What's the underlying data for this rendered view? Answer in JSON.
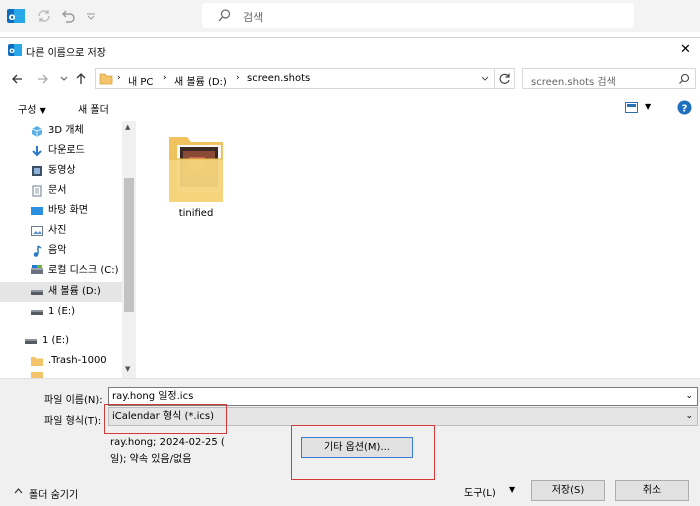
{
  "outlook": {
    "search_placeholder": "검색",
    "icons": [
      "outlook-logo-icon",
      "sync-icon",
      "undo-icon",
      "customize-quick-access-icon",
      "search-icon"
    ]
  },
  "dialog": {
    "title": "다른 이름으로 저장",
    "close_glyph": "✕",
    "breadcrumb": [
      "내 PC",
      "새 볼륨 (D:)",
      "screen.shots"
    ],
    "search_placeholder": "screen.shots 검색",
    "toolbar": {
      "organize": "구성",
      "new_folder": "새 폴더"
    },
    "nav_items": [
      {
        "label": "3D 개체",
        "icon": "3d-objects-icon"
      },
      {
        "label": "다운로드",
        "icon": "download-icon"
      },
      {
        "label": "동영상",
        "icon": "video-icon"
      },
      {
        "label": "문서",
        "icon": "document-icon"
      },
      {
        "label": "바탕 화면",
        "icon": "desktop-icon"
      },
      {
        "label": "사진",
        "icon": "pictures-icon"
      },
      {
        "label": "음악",
        "icon": "music-icon"
      },
      {
        "label": "로컬 디스크 (C:)",
        "icon": "drive-icon"
      },
      {
        "label": "새 볼륨 (D:)",
        "icon": "drive-icon",
        "selected": true
      },
      {
        "label": "1 (E:)",
        "icon": "drive-icon"
      }
    ],
    "tree2": [
      {
        "label": "1 (E:)",
        "icon": "drive-icon"
      },
      {
        "label": ".Trash-1000",
        "icon": "folder-icon"
      }
    ],
    "folder_name": "tinified",
    "filename_label": "파일 이름(N):",
    "filename_value": "ray.hong 일정.ics",
    "filetype_label": "파일 형식(T):",
    "filetype_value": "iCalendar 형식 (*.ics)",
    "info_line1": "ray.hong; 2024-02-25 (",
    "info_line2": "일); 약속 있음/없음",
    "more_options": "기타 옵션(M)...",
    "hide_folders": "폴더 숨기기",
    "tools": "도구(L)",
    "save": "저장(S)",
    "cancel": "취소"
  },
  "colors": {
    "outlook_blue": "#0f6cbd",
    "highlight_red": "#d43a3a",
    "folder_yellow": "#f3c46a"
  }
}
